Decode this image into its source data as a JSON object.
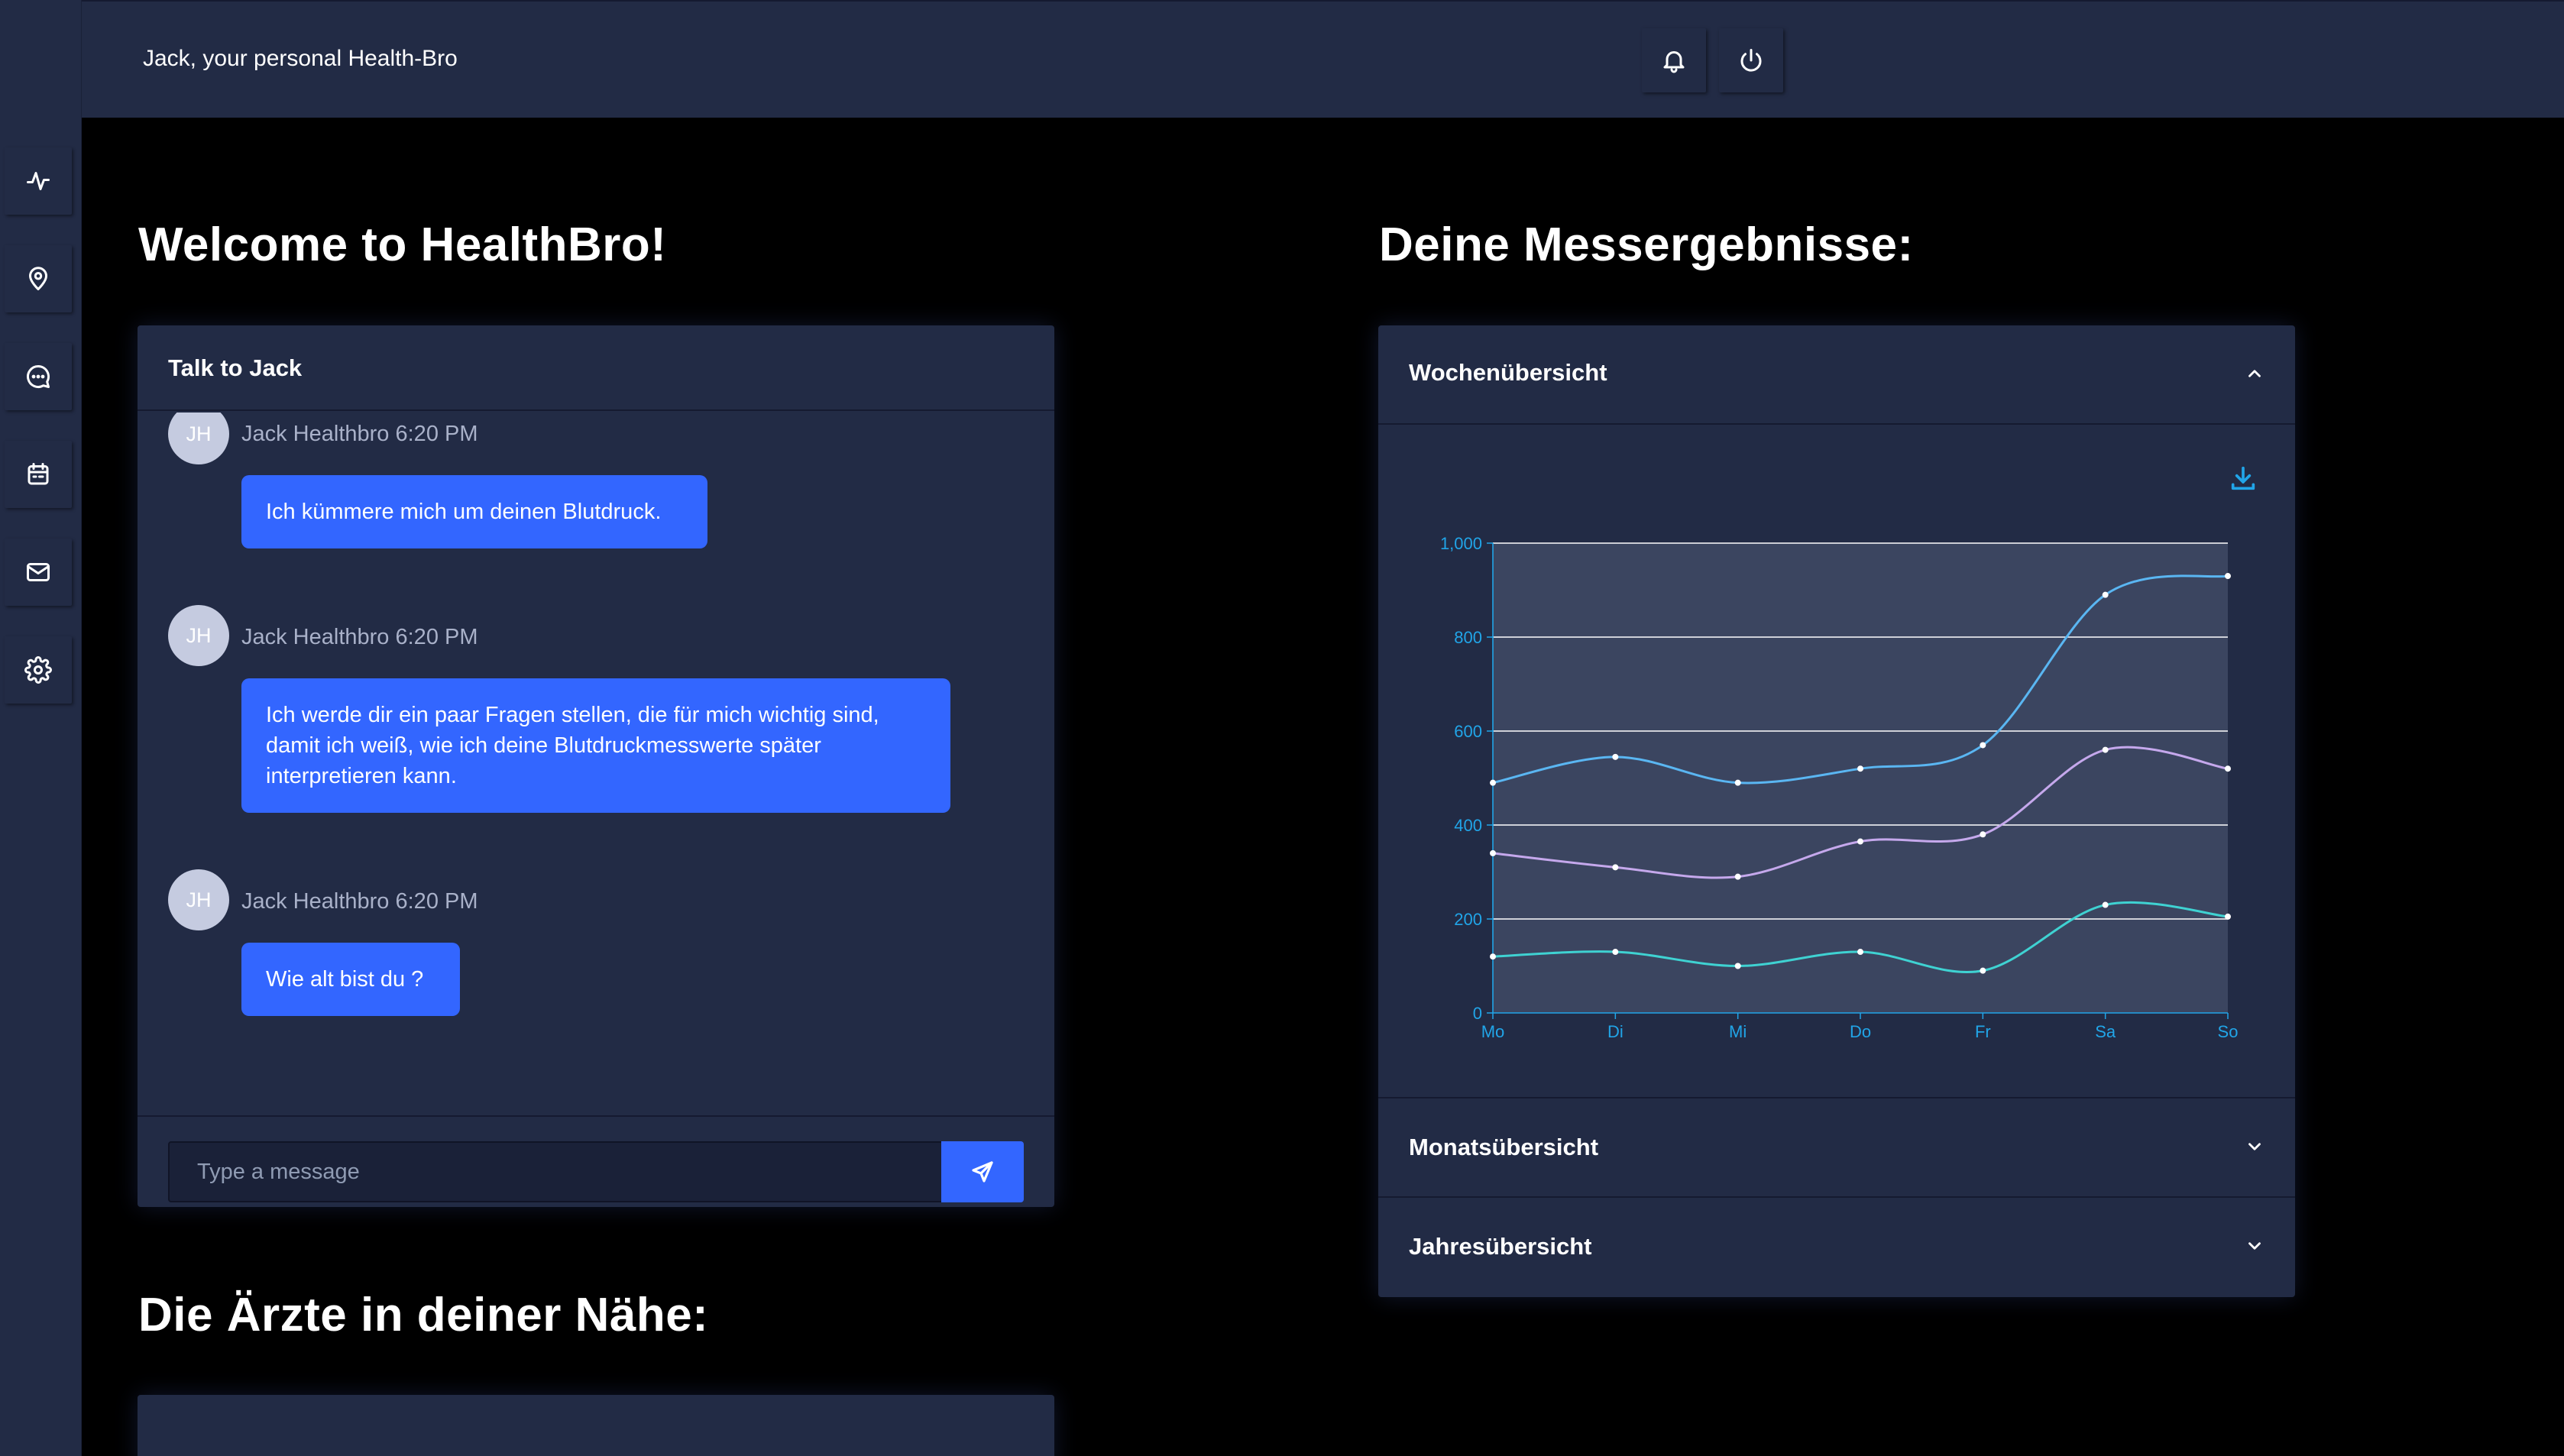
{
  "header": {
    "title": "Jack, your personal Health-Bro",
    "icons": [
      "bell-icon",
      "power-icon"
    ]
  },
  "sidebar": {
    "items": [
      {
        "icon": "activity-icon"
      },
      {
        "icon": "map-pin-icon"
      },
      {
        "icon": "message-icon"
      },
      {
        "icon": "calendar-icon"
      },
      {
        "icon": "mail-icon"
      },
      {
        "icon": "settings-icon"
      }
    ]
  },
  "welcome": {
    "heading": "Welcome to HealthBro!"
  },
  "chat": {
    "title": "Talk to Jack",
    "messages": [
      {
        "initials": "JH",
        "sender": "Jack Healthbro",
        "time": "6:20 PM",
        "text": "Ich kümmere mich um deinen Blutdruck."
      },
      {
        "initials": "JH",
        "sender": "Jack Healthbro",
        "time": "6:20 PM",
        "text": "Ich werde dir ein paar Fragen stellen, die für mich wichtig sind, damit ich weiß, wie ich deine Blutdruckmesswerte später interpretieren kann."
      },
      {
        "initials": "JH",
        "sender": "Jack Healthbro",
        "time": "6:20 PM",
        "text": "Wie alt bist du ?"
      }
    ],
    "input_placeholder": "Type a message",
    "input_value": ""
  },
  "doctors": {
    "heading": "Die Ärzte in deiner Nähe:"
  },
  "results": {
    "heading": "Deine Messergebnisse:",
    "panels": [
      {
        "title": "Wochenübersicht",
        "expanded": true
      },
      {
        "title": "Monatsübersicht",
        "expanded": false
      },
      {
        "title": "Jahresübersicht",
        "expanded": false
      }
    ]
  },
  "colors": {
    "accent": "#3366ff",
    "card": "#222b45",
    "axis": "#21a5e8",
    "series1": "#5ab6f2",
    "series2": "#c5a8ec",
    "series3": "#3fd2d2"
  },
  "chart_data": {
    "type": "line",
    "categories": [
      "Mo",
      "Di",
      "Mi",
      "Do",
      "Fr",
      "Sa",
      "So"
    ],
    "ylim": [
      0,
      1000
    ],
    "yticks": [
      "0",
      "200",
      "400",
      "600",
      "800",
      "1,000"
    ],
    "grid": true,
    "series": [
      {
        "values": [
          490,
          545,
          490,
          520,
          570,
          890,
          930
        ]
      },
      {
        "values": [
          340,
          310,
          290,
          365,
          380,
          560,
          520
        ]
      },
      {
        "values": [
          120,
          130,
          100,
          130,
          90,
          230,
          205
        ]
      }
    ]
  }
}
